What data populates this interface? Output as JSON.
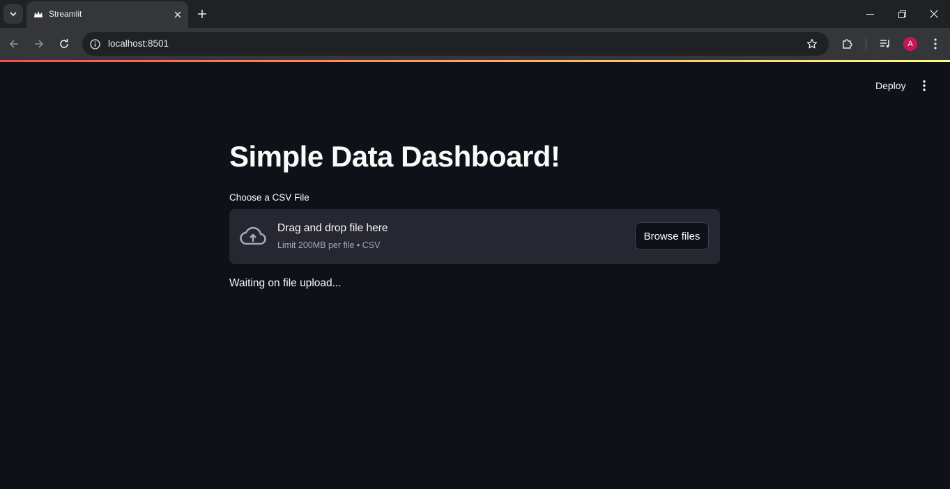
{
  "browser": {
    "tab_title": "Streamlit",
    "url": "localhost:8501",
    "profile_initial": "A"
  },
  "header": {
    "deploy_label": "Deploy"
  },
  "main": {
    "title": "Simple Data Dashboard!",
    "uploader_label": "Choose a CSV File",
    "dropzone_title": "Drag and drop file here",
    "dropzone_subtitle": "Limit 200MB per file • CSV",
    "browse_label": "Browse files",
    "status_text": "Waiting on file upload..."
  },
  "colors": {
    "background": "#0e1117",
    "dropzone": "#262730",
    "accent_start": "#ff4b4b",
    "accent_end": "#fffd80"
  },
  "icons": [
    "chevron-down-icon",
    "streamlit-crown-icon",
    "close-icon",
    "plus-icon",
    "minimize-icon",
    "restore-icon",
    "back-icon",
    "forward-icon",
    "reload-icon",
    "info-icon",
    "star-icon",
    "extensions-icon",
    "media-icon",
    "kebab-menu-icon",
    "cloud-upload-icon"
  ]
}
